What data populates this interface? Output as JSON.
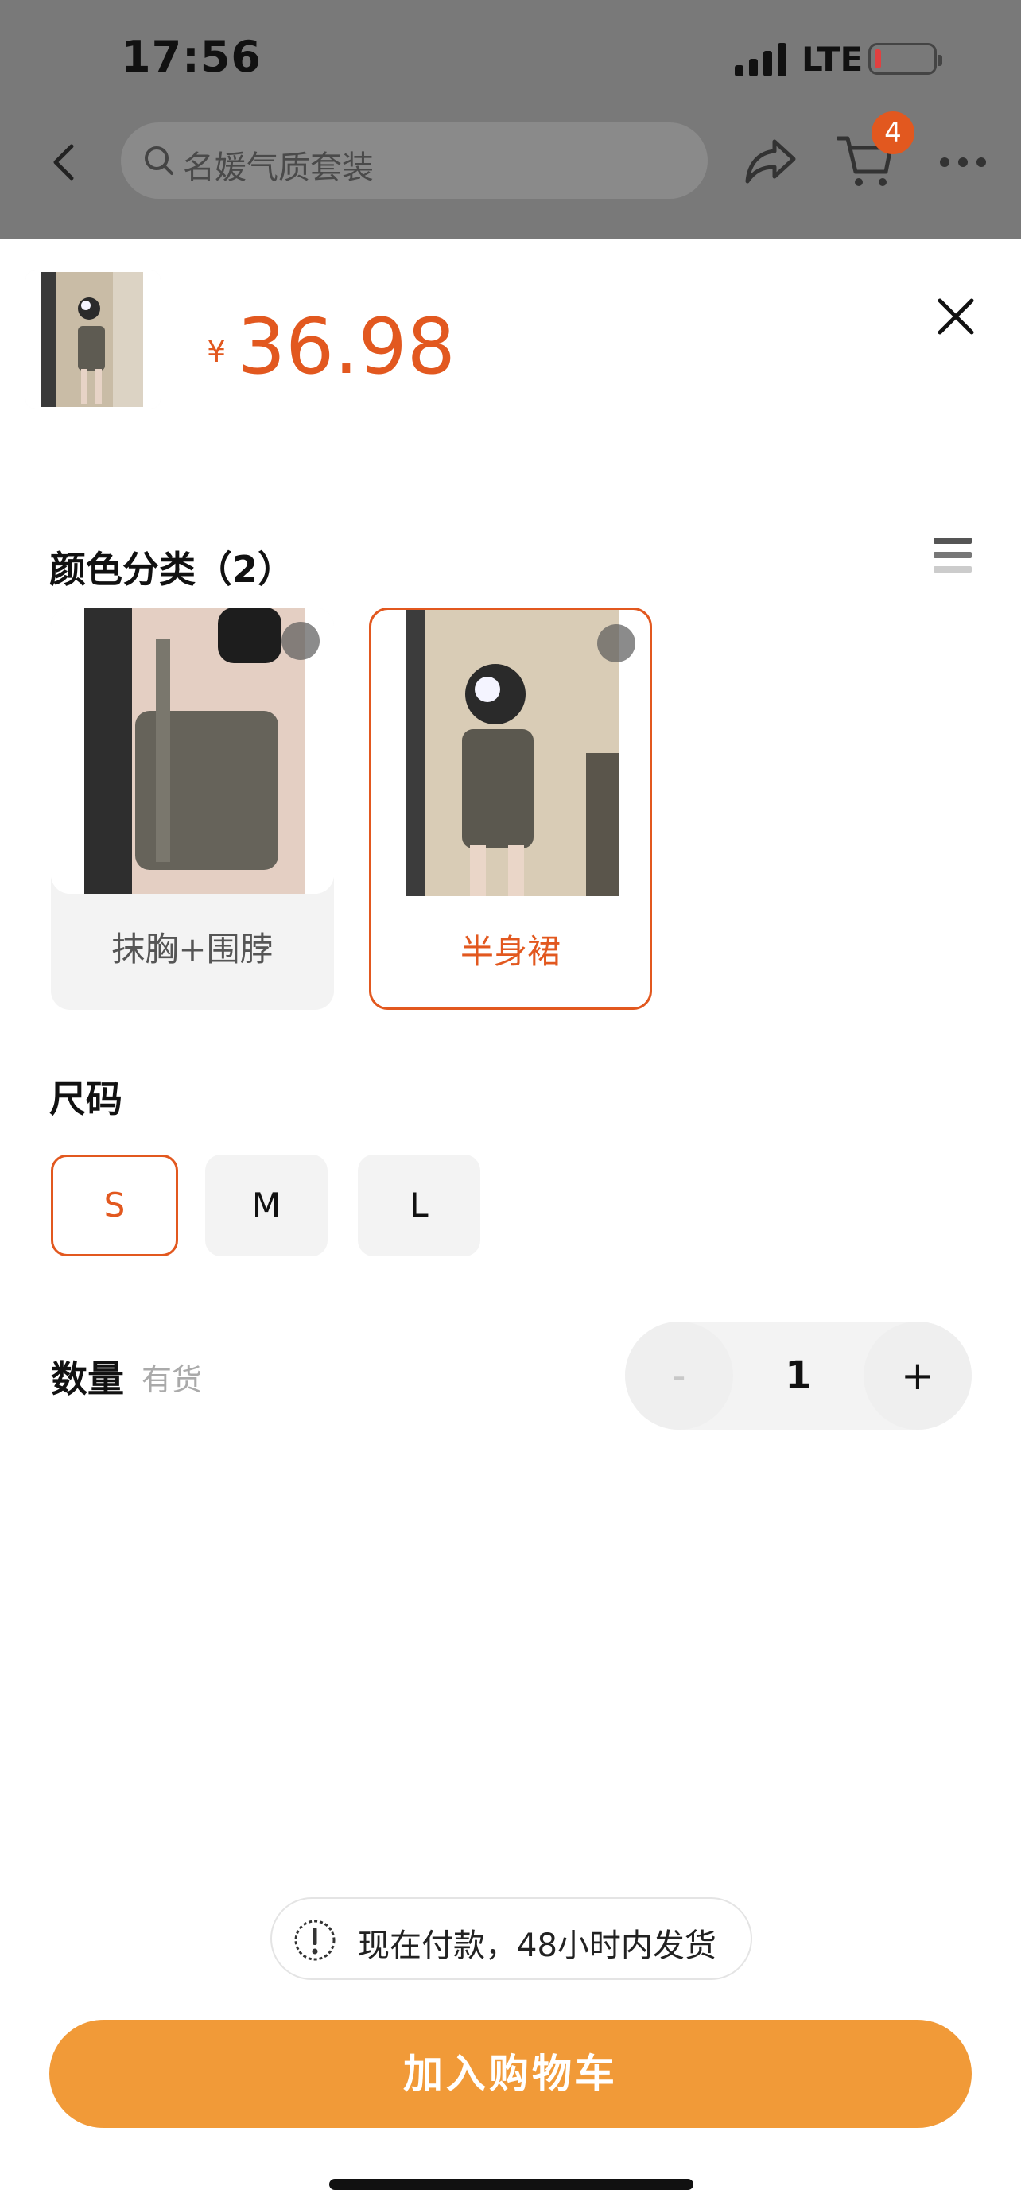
{
  "status_bar": {
    "time": "17:56",
    "network": "LTE"
  },
  "nav": {
    "search_placeholder": "名媛气质套装",
    "cart_count": "4"
  },
  "product": {
    "currency": "¥",
    "price": "36.98"
  },
  "color_section": {
    "title": "颜色分类（2）",
    "options": [
      {
        "label": "抹胸+围脖",
        "selected": false
      },
      {
        "label": "半身裙",
        "selected": true
      }
    ]
  },
  "size_section": {
    "title": "尺码",
    "options": [
      "S",
      "M",
      "L"
    ],
    "selected": "S"
  },
  "quantity": {
    "label": "数量",
    "stock": "有货",
    "minus": "-",
    "value": "1",
    "plus": "+"
  },
  "notice": {
    "text": "现在付款，48小时内发货"
  },
  "cta": {
    "label": "加入购物车"
  },
  "colors": {
    "accent": "#e2581f",
    "cta": "#f19a38",
    "overlay": "#797979"
  }
}
